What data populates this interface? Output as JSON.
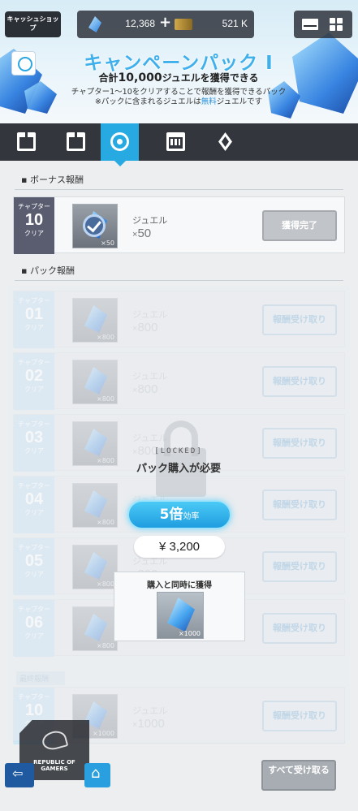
{
  "topbar": {
    "shop_label": "キャッシュショップ",
    "jewel_amount": "12,368",
    "plus": "+",
    "ticket_amount": "521 K"
  },
  "banner": {
    "title": "キャンペーンパック Ⅰ",
    "subtitle_prefix": "合計",
    "subtitle_amount": "10,000",
    "subtitle_suffix": "ジュエルを獲得できる",
    "desc_line1": "チャプター1～10をクリアすることで報酬を獲得できるパック",
    "desc_line2_a": "※パックに含まれるジュエルは",
    "desc_line2_b": "無料",
    "desc_line2_c": "ジュエルです"
  },
  "tabs": [
    {
      "icon": "gift-time-icon",
      "active": false
    },
    {
      "icon": "gift-icon",
      "active": false
    },
    {
      "icon": "target-icon",
      "active": true
    },
    {
      "icon": "calendar-icon",
      "active": false
    },
    {
      "icon": "diamond-icon",
      "active": false
    }
  ],
  "bonus": {
    "section_label": "▪ ボーナス報酬",
    "chapter_top": "チャプター",
    "chapter_num": "10",
    "chapter_bottom": "クリア",
    "item_name": "ジュエル",
    "item_qty": "50",
    "thumb_qty": "×50",
    "button": "獲得完了"
  },
  "pack": {
    "section_label": "▪ パック報酬",
    "chapter_top": "チャプター",
    "chapter_bottom": "クリア",
    "item_name": "ジュエル",
    "button": "報酬受け取り",
    "rows": [
      {
        "num": "01",
        "qty": "800",
        "thumb_qty": "×800"
      },
      {
        "num": "02",
        "qty": "800",
        "thumb_qty": "×800"
      },
      {
        "num": "03",
        "qty": "800",
        "thumb_qty": "×800"
      },
      {
        "num": "04",
        "qty": "800",
        "thumb_qty": "×800"
      },
      {
        "num": "05",
        "qty": "800",
        "thumb_qty": "×800"
      },
      {
        "num": "06",
        "qty": "800",
        "thumb_qty": "×800"
      }
    ],
    "final_label": "最終報酬",
    "final": {
      "num": "10",
      "qty": "1000",
      "thumb_qty": "×1000"
    }
  },
  "locked": {
    "tag": "[LOCKED]",
    "message": "パック購入が必要",
    "efficiency_value": "5倍",
    "efficiency_label": "効率",
    "price": "¥ 3,200",
    "instant_label": "購入と同時に獲得",
    "instant_qty": "×1000"
  },
  "footer": {
    "rog_text": "REPUBLIC OF GAMERS",
    "claim_all": "すべて受け取る"
  },
  "colors": {
    "accent": "#27a9e1",
    "tabbar": "#33363c",
    "chapter": "#5a5c70"
  }
}
